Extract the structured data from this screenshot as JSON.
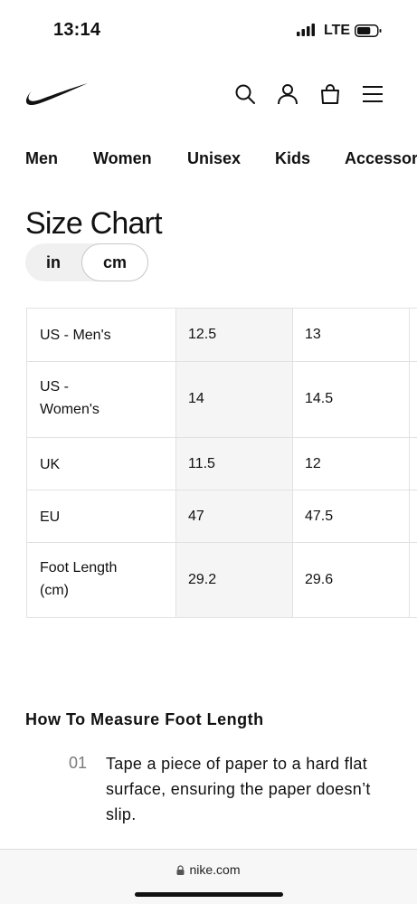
{
  "status_bar": {
    "time": "13:14",
    "network": "LTE",
    "battery_level": 0.7
  },
  "header": {
    "logo_icon": "nike-swoosh-icon",
    "icons": [
      "search-icon",
      "account-icon",
      "bag-icon",
      "menu-icon"
    ]
  },
  "nav": {
    "items": [
      "Men",
      "Women",
      "Unisex",
      "Kids",
      "Accessories"
    ]
  },
  "page": {
    "title": "Size Chart"
  },
  "unit_toggle": {
    "options": [
      "in",
      "cm"
    ],
    "selected": "cm"
  },
  "size_table": {
    "rows": [
      {
        "label": "US - Men's",
        "values": [
          "12.5",
          "13"
        ]
      },
      {
        "label": "US - Women's",
        "values": [
          "14",
          "14.5"
        ]
      },
      {
        "label": "UK",
        "values": [
          "11.5",
          "12"
        ]
      },
      {
        "label": "EU",
        "values": [
          "47",
          "47.5"
        ]
      },
      {
        "label": "Foot Length (cm)",
        "values": [
          "29.2",
          "29.6"
        ]
      }
    ]
  },
  "howto": {
    "title": "How To Measure Foot Length",
    "steps": [
      {
        "number": "01",
        "text": "Tape a piece of paper to a hard flat surface, ensuring the paper doesn’t slip."
      }
    ]
  },
  "browser": {
    "url": "nike.com"
  },
  "colors": {
    "text": "#111111",
    "muted": "#7a7a7a",
    "shade": "#f5f5f5",
    "border": "#e2e2e2"
  }
}
